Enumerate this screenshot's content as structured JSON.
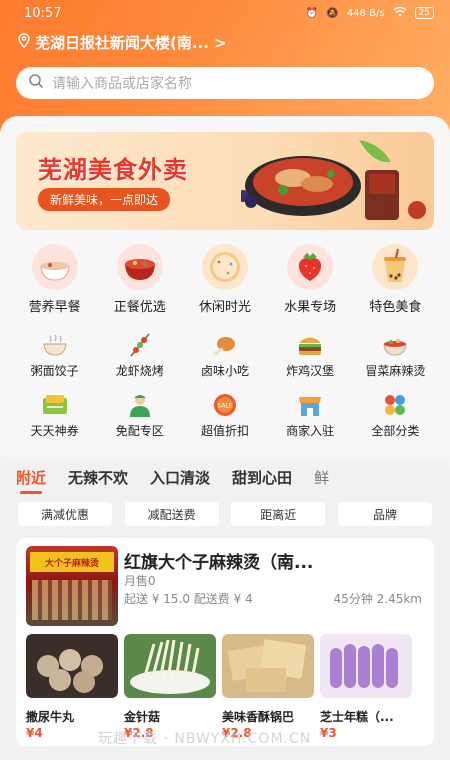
{
  "status": {
    "time": "10:57",
    "net_speed": "448 B/s",
    "battery": "25"
  },
  "location": {
    "label": "芜湖日报社新闻大楼(南...",
    "suffix": ">"
  },
  "search": {
    "placeholder": "请输入商品或店家名称"
  },
  "banner": {
    "title": "芜湖美食外卖",
    "subtitle": "新鲜美味，一点即达"
  },
  "categories_row1": [
    {
      "label": "营养早餐",
      "icon": "porridge-bowl-icon"
    },
    {
      "label": "正餐优选",
      "icon": "hotpot-bowl-icon"
    },
    {
      "label": "休闲时光",
      "icon": "donut-icon"
    },
    {
      "label": "水果专场",
      "icon": "strawberry-icon"
    },
    {
      "label": "特色美食",
      "icon": "bubble-tea-icon"
    }
  ],
  "categories_row2": [
    {
      "label": "粥面饺子",
      "icon": "noodle-bowl-icon"
    },
    {
      "label": "龙虾烧烤",
      "icon": "skewer-icon"
    },
    {
      "label": "卤味小吃",
      "icon": "drumstick-icon"
    },
    {
      "label": "炸鸡汉堡",
      "icon": "burger-icon"
    },
    {
      "label": "冒菜麻辣烫",
      "icon": "spicy-pot-icon"
    }
  ],
  "categories_row3": [
    {
      "label": "天天神券",
      "icon": "coupon-icon"
    },
    {
      "label": "免配专区",
      "icon": "delivery-person-icon"
    },
    {
      "label": "超值折扣",
      "icon": "sale-badge-icon"
    },
    {
      "label": "商家入驻",
      "icon": "shop-icon"
    },
    {
      "label": "全部分类",
      "icon": "grid-icon"
    }
  ],
  "tabs": [
    "附近",
    "无辣不欢",
    "入口清淡",
    "甜到心田",
    "鲜"
  ],
  "filters": [
    "满减优惠",
    "减配送费",
    "距离近",
    "品牌"
  ],
  "shop": {
    "name": "红旗大个子麻辣烫（南...",
    "sign": "大个子麻辣烫",
    "sales": "月售0",
    "meta": "起送 ¥ 15.0  配送费 ¥ 4",
    "time_distance": "45分钟  2.45km",
    "dishes": [
      {
        "name": "撒尿牛丸",
        "price": "¥4"
      },
      {
        "name": "金针菇",
        "price": "¥2.8"
      },
      {
        "name": "美味香酥锅巴",
        "price": "¥2.8"
      },
      {
        "name": "芝士年糕（...",
        "price": "¥3"
      }
    ]
  },
  "watermark": "玩趣下载 · NBWYXH.COM.CN",
  "colors": {
    "accent": "#f0552a",
    "header_start": "#ff7a2e",
    "header_end": "#ffb066"
  }
}
